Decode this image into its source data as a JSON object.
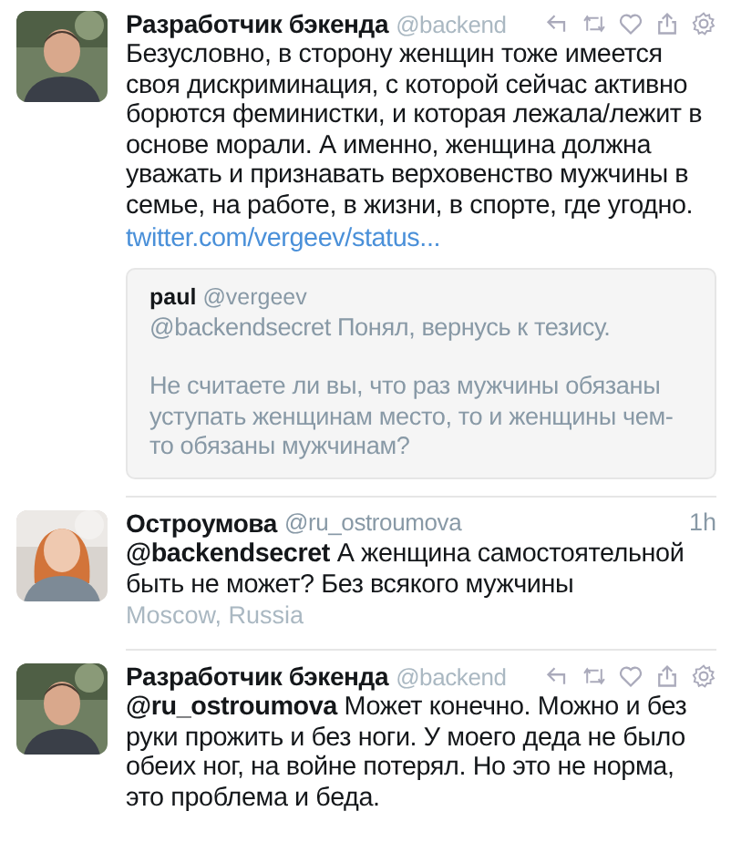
{
  "tweets": [
    {
      "kind": "actions",
      "name": "Разработчик бэкенда",
      "handle": "@backend",
      "body": "Безусловно, в сторону женщин тоже имеется своя дискриминация, с которой сейчас активно борются феминистки, и которая лежала/лежит в основе морали. А именно, женщина должна уважать и признавать верховенство мужчины в семье, на работе, в жизни, в спорте, где угодно.",
      "link": "twitter.com/vergeev/status...",
      "quote": {
        "name": "paul",
        "handle": "@vergeev",
        "paragraphs": [
          "@backendsecret Понял, вернусь к тезису.",
          "Не считаете ли вы, что раз мужчины обязаны уступать женщинам место, то и женщины чем-то обязаны мужчинам?"
        ]
      }
    },
    {
      "kind": "time",
      "name": "Остроумова",
      "handle": "@ru_ostroumova",
      "time": "1h",
      "body": "**@backendsecret** А женщина самостоятельной быть не может? Без всякого мужчины",
      "location": "Moscow, Russia"
    },
    {
      "kind": "actions",
      "name": "Разработчик бэкенда",
      "handle": "@backend",
      "body": "**@ru_ostroumova** Может конечно. Можно и без руки прожить и без ноги. У моего деда не было обеих ног, на войне потерял. Но это не норма, это проблема и беда."
    }
  ]
}
